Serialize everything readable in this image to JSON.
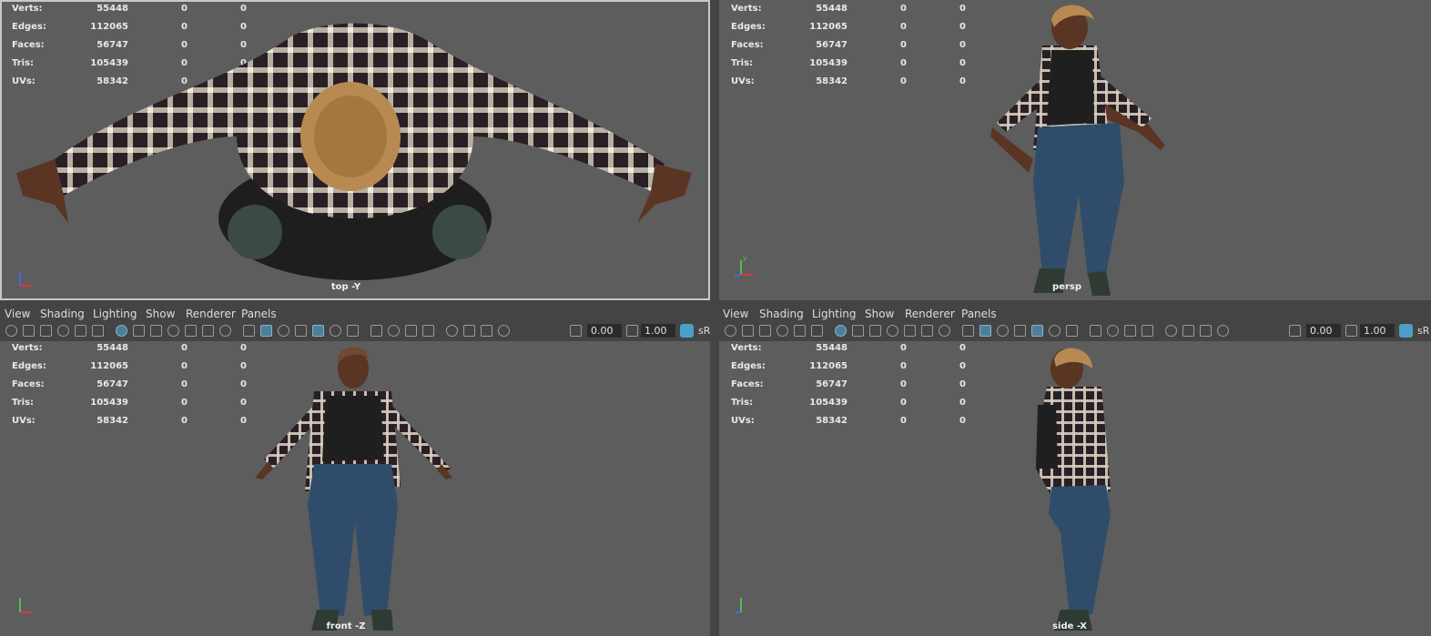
{
  "menu": [
    "View",
    "Shading",
    "Lighting",
    "Show",
    "Renderer",
    "Panels"
  ],
  "hud": {
    "rows": [
      {
        "label": "Verts:",
        "total": "55448",
        "sel": "0",
        "comp": "0"
      },
      {
        "label": "Edges:",
        "total": "112065",
        "sel": "0",
        "comp": "0"
      },
      {
        "label": "Faces:",
        "total": "56747",
        "sel": "0",
        "comp": "0"
      },
      {
        "label": "Tris:",
        "total": "105439",
        "sel": "0",
        "comp": "0"
      },
      {
        "label": "UVs:",
        "total": "58342",
        "sel": "0",
        "comp": "0"
      }
    ]
  },
  "viewports": {
    "top": {
      "camera": "top -Y"
    },
    "persp": {
      "camera": "persp"
    },
    "front": {
      "camera": "front -Z"
    },
    "side": {
      "camera": "side -X"
    }
  },
  "toolbar": {
    "exposure": "0.00",
    "gamma": "1.00",
    "colorspace": "sR"
  },
  "axes": {
    "top": [
      "y",
      "x"
    ],
    "persp": [
      "y",
      "x"
    ],
    "front": [
      "y",
      "x"
    ],
    "side": [
      "y",
      "z"
    ]
  },
  "colors": {
    "viewport_bg": "#5d5d5d",
    "panel_bg": "#444444",
    "shirt_dark": "#2a1f24",
    "shirt_light": "#cfc9b8",
    "jeans": "#2f4c6a",
    "skin": "#5a3524",
    "hair": "#b88a52",
    "axis_x": "#d23a3a",
    "axis_y": "#4fbf4f",
    "axis_z": "#3f6fe0",
    "active_icon": "#4aa0c8"
  },
  "icons": {
    "toolbar": [
      "camera-icon",
      "camera-attr-icon",
      "bookmark-icon",
      "image-plane-icon",
      "grease-pencil-icon",
      "2d-pan-icon",
      "grid-icon",
      "film-gate-icon",
      "resolution-gate-icon",
      "gate-mask-icon",
      "field-chart-icon",
      "safe-action-icon",
      "safe-title-icon",
      "wireframe-icon",
      "smooth-shade-icon",
      "use-default-material-icon",
      "wireframe-on-shaded-icon",
      "xray-icon",
      "default-light-icon",
      "shadows-icon",
      "screen-ao-icon",
      "motion-blur-icon",
      "multisample-aa-icon",
      "depth-of-field-icon",
      "isolate-select-icon",
      "xray-joints-icon",
      "xray-active-icon",
      "backface-cull-icon",
      "exposure-icon",
      "gamma-icon",
      "color-management-icon"
    ]
  }
}
